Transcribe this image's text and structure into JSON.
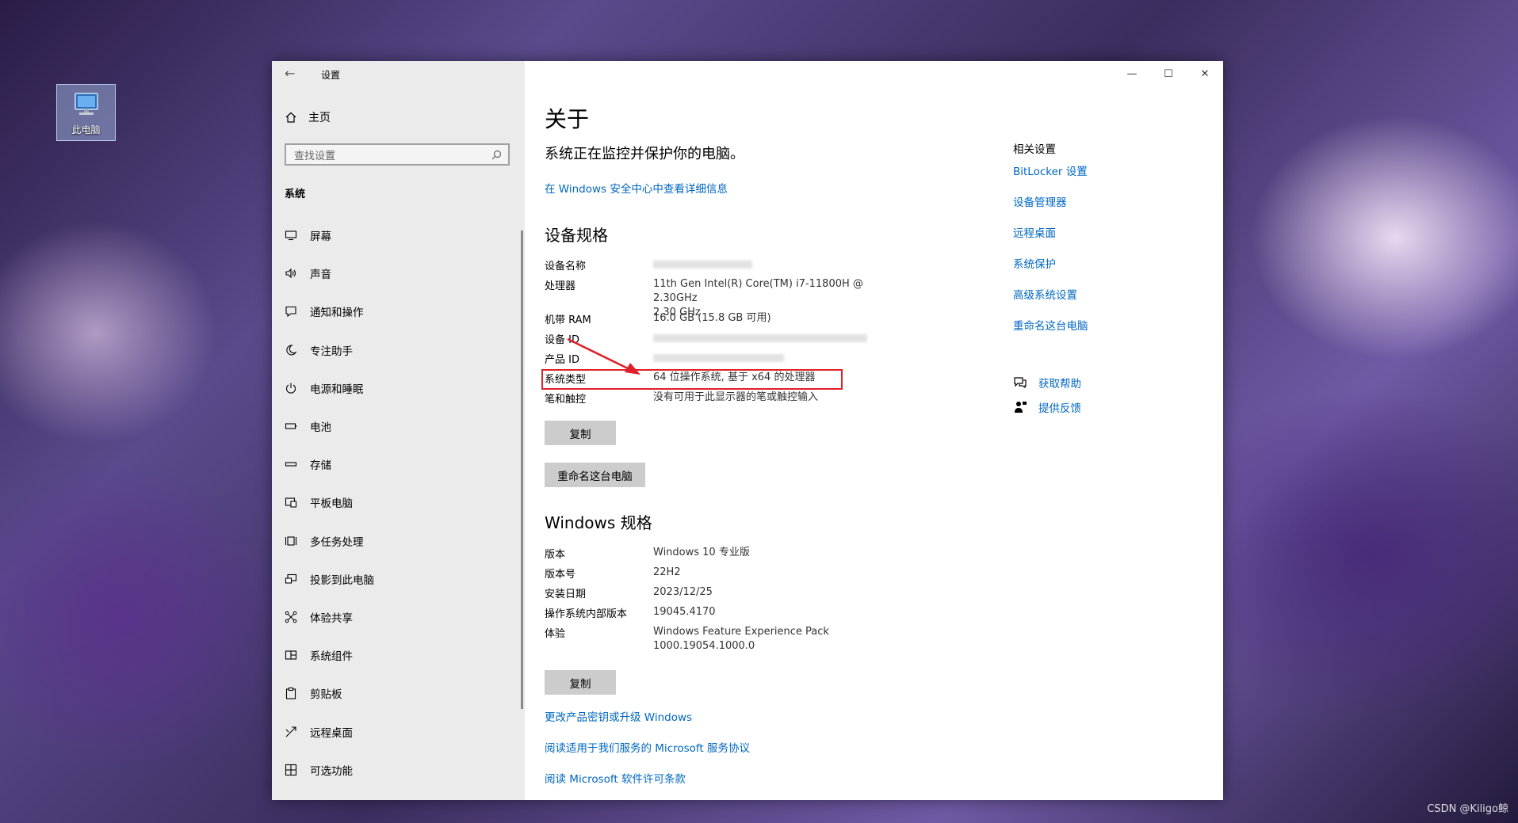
{
  "desktop": {
    "icon_label": "此电脑",
    "watermark": "CSDN @Kiligo鲸"
  },
  "window": {
    "title": "设置",
    "controls": [
      "minimize",
      "maximize",
      "close"
    ]
  },
  "sidebar": {
    "home": "主页",
    "search_placeholder": "查找设置",
    "section": "系统",
    "items": [
      {
        "label": "屏幕",
        "icon": "monitor-icon"
      },
      {
        "label": "声音",
        "icon": "speaker-icon"
      },
      {
        "label": "通知和操作",
        "icon": "notification-icon"
      },
      {
        "label": "专注助手",
        "icon": "moon-icon"
      },
      {
        "label": "电源和睡眠",
        "icon": "power-icon"
      },
      {
        "label": "电池",
        "icon": "battery-icon"
      },
      {
        "label": "存储",
        "icon": "storage-icon"
      },
      {
        "label": "平板电脑",
        "icon": "tablet-icon"
      },
      {
        "label": "多任务处理",
        "icon": "multitask-icon"
      },
      {
        "label": "投影到此电脑",
        "icon": "project-icon"
      },
      {
        "label": "体验共享",
        "icon": "share-icon"
      },
      {
        "label": "系统组件",
        "icon": "components-icon"
      },
      {
        "label": "剪贴板",
        "icon": "clipboard-icon"
      },
      {
        "label": "远程桌面",
        "icon": "remote-desktop-icon"
      },
      {
        "label": "可选功能",
        "icon": "optional-features-icon"
      }
    ]
  },
  "main": {
    "title": "关于",
    "subtitle": "系统正在监控并保护你的电脑。",
    "security_link": "在 Windows 安全中心中查看详细信息",
    "device_specs": {
      "heading": "设备规格",
      "rows": [
        {
          "key": "设备名称",
          "value": ""
        },
        {
          "key": "处理器",
          "value": "11th Gen Intel(R) Core(TM) i7-11800H @ 2.30GHz",
          "value2": "2.30 GHz"
        },
        {
          "key": "机带 RAM",
          "value": "16.0 GB (15.8 GB 可用)"
        },
        {
          "key": "设备 ID",
          "value": ""
        },
        {
          "key": "产品 ID",
          "value": ""
        },
        {
          "key": "系统类型",
          "value": "64 位操作系统, 基于 x64 的处理器"
        },
        {
          "key": "笔和触控",
          "value": "没有可用于此显示器的笔或触控输入"
        }
      ],
      "copy_button": "复制",
      "rename_button": "重命名这台电脑"
    },
    "windows_specs": {
      "heading": "Windows 规格",
      "rows": [
        {
          "key": "版本",
          "value": "Windows 10 专业版"
        },
        {
          "key": "版本号",
          "value": "22H2"
        },
        {
          "key": "安装日期",
          "value": "2023/12/25"
        },
        {
          "key": "操作系统内部版本",
          "value": "19045.4170"
        },
        {
          "key": "体验",
          "value": "Windows Feature Experience Pack",
          "value2": "1000.19054.1000.0"
        }
      ],
      "copy_button": "复制"
    },
    "bottom_links": [
      "更改产品密钥或升级 Windows",
      "阅读适用于我们服务的 Microsoft 服务协议",
      "阅读 Microsoft 软件许可条款"
    ]
  },
  "related": {
    "title": "相关设置",
    "links": [
      "BitLocker 设置",
      "设备管理器",
      "远程桌面",
      "系统保护",
      "高级系统设置",
      "重命名这台电脑"
    ],
    "help": "获取帮助",
    "feedback": "提供反馈"
  },
  "colors": {
    "accent": "#0067c0",
    "highlight_box": "#e0202a",
    "sidebar_bg": "#ebebeb",
    "button_bg": "#cccccc"
  }
}
